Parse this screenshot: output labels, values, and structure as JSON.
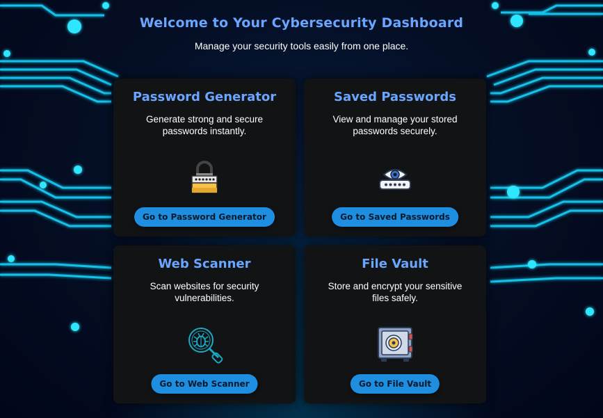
{
  "header": {
    "title": "Welcome to Your Cybersecurity Dashboard",
    "subtitle": "Manage your security tools easily from one place."
  },
  "cards": [
    {
      "title": "Password Generator",
      "description": "Generate strong and secure passwords instantly.",
      "icon": "padlock-icon",
      "button_label": "Go to Password Generator"
    },
    {
      "title": "Saved Passwords",
      "description": "View and manage your stored passwords securely.",
      "icon": "eye-password-icon",
      "button_label": "Go to Saved Passwords"
    },
    {
      "title": "Web Scanner",
      "description": "Scan websites for security vulnerabilities.",
      "icon": "bug-magnifier-icon",
      "button_label": "Go to Web Scanner"
    },
    {
      "title": "File Vault",
      "description": "Store and encrypt your sensitive files safely.",
      "icon": "vault-safe-icon",
      "button_label": "Go to File Vault"
    }
  ],
  "colors": {
    "accent": "#6aa6ff",
    "button": "#1e8ee0",
    "card": "#111315",
    "background": "#030a1c",
    "circuit": "#19d6ff"
  }
}
